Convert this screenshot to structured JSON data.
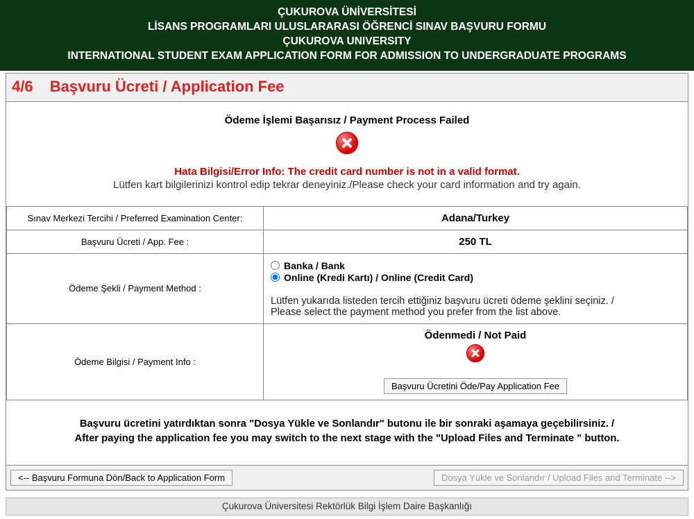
{
  "header": {
    "line1": "ÇUKUROVA ÜNİVERSİTESİ",
    "line2": "LİSANS PROGRAMLARI ULUSLARARASI ÖĞRENCİ SINAV BAŞVURU FORMU",
    "line3": "ÇUKUROVA UNIVERSITY",
    "line4": "INTERNATIONAL STUDENT EXAM APPLICATION FORM FOR ADMISSION TO UNDERGRADUATE PROGRAMS"
  },
  "section": {
    "step": "4/6",
    "title": "Başvuru Ücreti / Application Fee"
  },
  "status": {
    "title": "Ödeme İşlemi Başarısız / Payment Process Failed",
    "error_info": "Hata Bilgisi/Error Info: The credit card number is not in a valid format.",
    "hint": "Lütfen kart bilgilerinizi kontrol edip tekrar deneyiniz./Please check your card information and try again."
  },
  "rows": {
    "exam_center_label": "Sınav Merkezi Tercihi / Preferred Examination Center:",
    "exam_center_value": "Adana/Turkey",
    "fee_label": "Başvuru Ücreti / App. Fee :",
    "fee_value": "250 TL",
    "method_label": "Ödeme Şekli / Payment Method :",
    "method_options": {
      "bank": "Banka / Bank",
      "online": "Online (Kredi Kartı) / Online (Credit Card)"
    },
    "method_selected": "online",
    "method_note_line1": "Lütfen yukarıda listeden tercih ettiğiniz başvuru ücreti ödeme şeklini seçiniz. /",
    "method_note_line2": "Please select the payment method you prefer from the list above.",
    "payment_info_label": "Ödeme Bilgisi / Payment Info :",
    "payment_status": "Ödenmedi / Not Paid",
    "pay_button": "Başvuru Ücretini Öde/Pay Application Fee"
  },
  "instructions": {
    "line1": "Başvuru ücretini yatırdıktan sonra \"Dosya Yükle ve Sonlandır\" butonu ile bir sonraki aşamaya geçebilirsiniz. /",
    "line2": "After paying the application fee you may switch to the next stage with the \"Upload Files and Terminate \" button."
  },
  "nav": {
    "back": "<-- Başvuru Formuna Dön/Back to Application Form",
    "next": "Dosya Yükle ve Sonlandır / Upload Files and Terminate -->"
  },
  "footer": "Çukurova Üniversitesi Rektörlük Bilgi İşlem Daire Başkanlığı"
}
